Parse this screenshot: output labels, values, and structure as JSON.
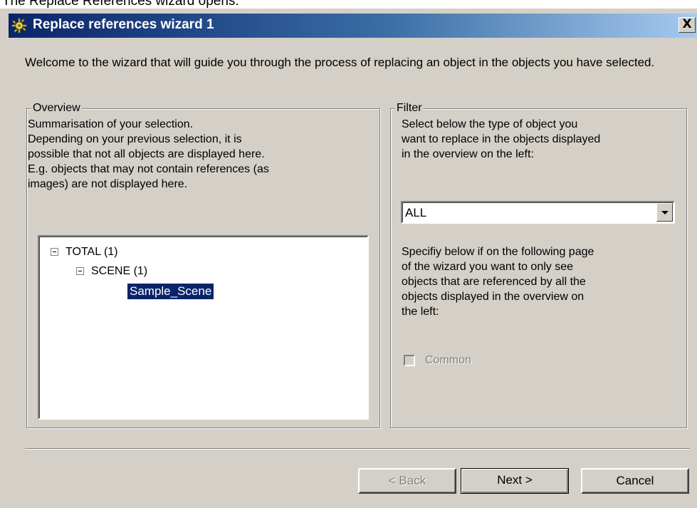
{
  "caption": "The Replace References wizard opens:",
  "window": {
    "title": "Replace references wizard 1",
    "close_label": "X"
  },
  "welcome_text": "Welcome to the wizard that will guide you through the process of replacing an object in the objects you have selected.",
  "overview": {
    "legend": "Overview",
    "description_lines": [
      "Summarisation of your selection.",
      "Depending on your previous selection, it is",
      "possible that not all objects are displayed here.",
      "E.g. objects that may not contain references (as",
      "images) are not displayed here."
    ],
    "tree": {
      "root": "TOTAL (1)",
      "child": "SCENE (1)",
      "leaf": "Sample_Scene"
    }
  },
  "filter": {
    "legend": "Filter",
    "description_lines": [
      "Select below the type of object you",
      "want to replace in the objects displayed",
      "in the overview on the left:"
    ],
    "combo_value": "ALL",
    "specify_lines": [
      "Specifiy below if on the following page",
      "of the wizard you want to only see",
      "objects that are referenced by all the",
      "objects displayed in the overview on",
      "the left:"
    ],
    "checkbox_label": "Common"
  },
  "buttons": {
    "back": "< Back",
    "next": "Next >",
    "cancel": "Cancel"
  },
  "colors": {
    "title_gradient_start": "#0a246a",
    "title_gradient_end": "#a6caf0",
    "dialog_face": "#d4d0c8",
    "selection": "#0a246a"
  },
  "icons": {
    "title": "gear-icon",
    "tree_expand": "minus-box-icon",
    "combo": "chevron-down-icon"
  }
}
